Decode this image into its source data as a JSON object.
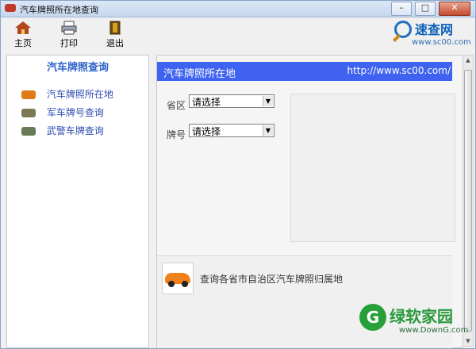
{
  "window": {
    "title": "汽车牌照所在地查询",
    "minimize": "–",
    "maximize": "□",
    "close": "✕"
  },
  "toolbar": {
    "home_label": "主页",
    "print_label": "打印",
    "exit_label": "退出"
  },
  "brand": {
    "name": "速查网",
    "url": "www.sc00.com"
  },
  "sidebar": {
    "title": "汽车牌照查询",
    "items": [
      {
        "label": "汽车牌照所在地",
        "icon": "car-icon"
      },
      {
        "label": "军车牌号查询",
        "icon": "military-car-icon"
      },
      {
        "label": "武警车牌查询",
        "icon": "armed-police-car-icon"
      }
    ]
  },
  "main": {
    "header_title": "汽车牌照所在地",
    "header_url": "http://www.sc00.com/",
    "province_label": "省区",
    "province_value": "请选择",
    "plate_label": "牌号",
    "plate_value": "请选择",
    "info_text": "查询各省市自治区汽车牌照归属地"
  },
  "watermark": {
    "name": "绿软家园",
    "url": "www.DownG.com"
  }
}
